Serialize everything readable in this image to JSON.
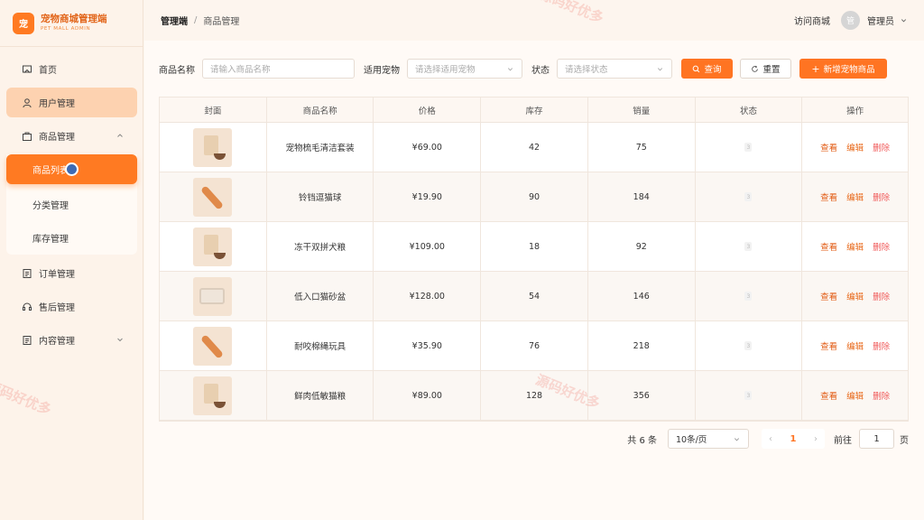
{
  "brand": {
    "logo": "宠",
    "title": "宠物商城管理端",
    "subtitle": "PET MALL ADMIN"
  },
  "sidebar": {
    "items": [
      {
        "label": "首页",
        "icon": "home-icon"
      },
      {
        "label": "用户管理",
        "icon": "user-icon"
      },
      {
        "label": "商品管理",
        "icon": "bag-icon"
      },
      {
        "label": "订单管理",
        "icon": "document-icon"
      },
      {
        "label": "售后管理",
        "icon": "headset-icon"
      },
      {
        "label": "内容管理",
        "icon": "document-icon"
      }
    ],
    "submenu": [
      {
        "label": "商品列表"
      },
      {
        "label": "分类管理"
      },
      {
        "label": "库存管理"
      }
    ]
  },
  "header": {
    "breadcrumb_root": "管理端",
    "breadcrumb_sep": "/",
    "breadcrumb_current": "商品管理",
    "visit_store": "访问商城",
    "avatar": "管",
    "username": "管理员"
  },
  "filter": {
    "name_label": "商品名称",
    "name_placeholder": "请输入商品名称",
    "pet_label": "适用宠物",
    "pet_placeholder": "请选择适用宠物",
    "status_label": "状态",
    "status_placeholder": "请选择状态",
    "search_btn": "查询",
    "reset_btn": "重置",
    "add_btn": "新增宠物商品"
  },
  "table": {
    "columns": [
      "封面",
      "商品名称",
      "价格",
      "库存",
      "销量",
      "状态",
      "操作"
    ],
    "rows": [
      {
        "name": "宠物梳毛清洁套装",
        "price": "¥69.00",
        "stock": "42",
        "sales": "75",
        "thumb": "bag"
      },
      {
        "name": "铃铛逗猫球",
        "price": "¥19.90",
        "stock": "90",
        "sales": "184",
        "thumb": "rope"
      },
      {
        "name": "冻干双拼犬粮",
        "price": "¥109.00",
        "stock": "18",
        "sales": "92",
        "thumb": "bag"
      },
      {
        "name": "低入口猫砂盆",
        "price": "¥128.00",
        "stock": "54",
        "sales": "146",
        "thumb": "box"
      },
      {
        "name": "耐咬棉绳玩具",
        "price": "¥35.90",
        "stock": "76",
        "sales": "218",
        "thumb": "rope"
      },
      {
        "name": "鲜肉低敏猫粮",
        "price": "¥89.00",
        "stock": "128",
        "sales": "356",
        "thumb": "bag"
      }
    ],
    "status_glyph": "3",
    "actions": {
      "view": "查看",
      "edit": "编辑",
      "delete": "删除"
    }
  },
  "pager": {
    "total": "共 6 条",
    "page_size": "10条/页",
    "prev": "‹",
    "current": "1",
    "next": "›",
    "goto_label": "前往",
    "goto_value": "1",
    "page_word": "页"
  },
  "watermark": "源码好优多",
  "colors": {
    "accent": "#ff7422",
    "sidebar_bg": "#fdf3ea",
    "delete": "#f05a5a"
  }
}
